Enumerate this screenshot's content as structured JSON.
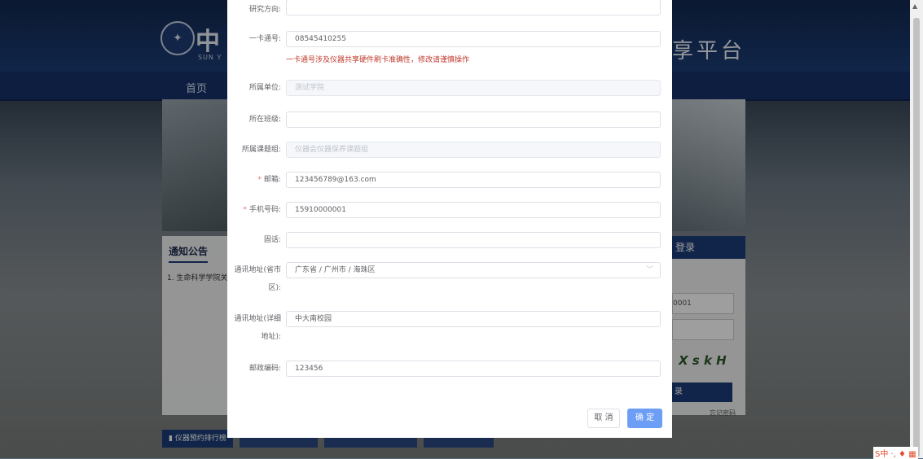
{
  "background": {
    "logo_text": "中",
    "logo_sub": "SUN Y",
    "platform_title": "享平台",
    "nav_home": "首页",
    "notice_title": "通知公告",
    "notice_item": "1. 生命科学学院关",
    "login_title": "登录",
    "login_field_value": "0001",
    "captcha_text": "X s k H",
    "login_button": "录",
    "forgot": "忘记密码",
    "tabs": [
      "仪器预约排行榜",
      "",
      "",
      ""
    ]
  },
  "form": {
    "fields": [
      {
        "label": "研究方向:",
        "value": "",
        "placeholder": "",
        "disabled": false,
        "required": false
      },
      {
        "label": "一卡通号:",
        "value": "08545410255",
        "placeholder": "",
        "disabled": false,
        "required": false
      },
      {
        "label": "所属单位:",
        "value": "",
        "placeholder": "测试学院",
        "disabled": true,
        "required": false
      },
      {
        "label": "所在班级:",
        "value": "",
        "placeholder": "",
        "disabled": false,
        "required": false
      },
      {
        "label": "所属课题组:",
        "value": "",
        "placeholder": "仪器会仪器保养课题组",
        "disabled": true,
        "required": false
      },
      {
        "label": "邮箱:",
        "value": "123456789@163.com",
        "placeholder": "",
        "disabled": false,
        "required": true
      },
      {
        "label": "手机号码:",
        "value": "15910000001",
        "placeholder": "",
        "disabled": false,
        "required": true
      },
      {
        "label": "固话:",
        "value": "",
        "placeholder": "",
        "disabled": false,
        "required": false
      },
      {
        "label": "通讯地址(省市区):",
        "value": "广东省 / 广州市 / 海珠区",
        "placeholder": "",
        "disabled": false,
        "required": false
      },
      {
        "label": "通讯地址(详细地址):",
        "value": "中大南校园",
        "placeholder": "",
        "disabled": false,
        "required": false
      },
      {
        "label": "邮政编码:",
        "value": "123456",
        "placeholder": "",
        "disabled": false,
        "required": false
      }
    ],
    "card_hint": "一卡通号涉及仪器共享硬件刷卡准确性，修改请谨慎操作",
    "required_mark": "*",
    "select_caret": "﹀",
    "cancel_label": "取 消",
    "confirm_label": "确 定"
  },
  "system": {
    "tray_text": "S中 ·, ♦ ▦"
  },
  "colors": {
    "primary": "#6d9ef5",
    "hint": "#c0392b",
    "required": "#f56c6c",
    "navy": "#1c3d78"
  }
}
